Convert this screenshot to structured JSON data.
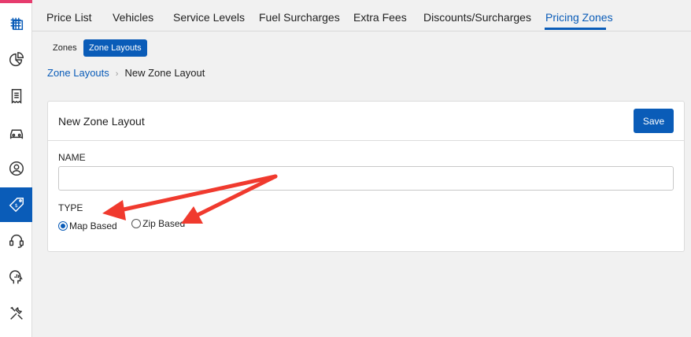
{
  "sidebar": {
    "icons": [
      "logo-icon",
      "pie-chart-icon",
      "receipt-icon",
      "car-icon",
      "user-circle-icon",
      "price-tag-icon",
      "headset-icon",
      "brain-chart-icon",
      "tools-icon"
    ],
    "accent": "#e63c6e",
    "active_color": "#0a5cb8"
  },
  "tabs": [
    {
      "label": "Price List"
    },
    {
      "label": "Vehicles"
    },
    {
      "label": "Service Levels"
    },
    {
      "label": "Fuel Surcharges"
    },
    {
      "label": "Extra Fees"
    },
    {
      "label": "Discounts/Surcharges"
    },
    {
      "label": "Pricing Zones"
    }
  ],
  "active_tab": "Pricing Zones",
  "subtabs": [
    {
      "label": "Zones"
    },
    {
      "label": "Zone Layouts"
    }
  ],
  "active_subtab": "Zone Layouts",
  "breadcrumb": {
    "parent": "Zone Layouts",
    "separator": "›",
    "current": "New Zone Layout"
  },
  "form": {
    "title": "New Zone Layout",
    "save_label": "Save",
    "name_label": "NAME",
    "name_value": "",
    "type_label": "TYPE",
    "type_options": [
      {
        "label": "Map Based",
        "checked": true
      },
      {
        "label": "Zip Based",
        "checked": false
      }
    ]
  },
  "colors": {
    "primary": "#0a5cb8",
    "annotation_arrow": "#f03a2e"
  }
}
